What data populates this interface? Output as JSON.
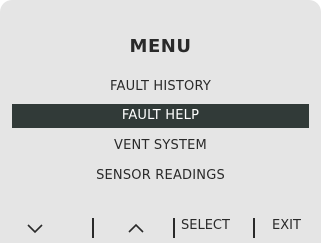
{
  "menu": {
    "title": "MENU",
    "items": [
      {
        "label": "FAULT HISTORY",
        "selected": false
      },
      {
        "label": "FAULT HELP",
        "selected": true
      },
      {
        "label": "VENT SYSTEM",
        "selected": false
      },
      {
        "label": "SENSOR READINGS",
        "selected": false
      }
    ]
  },
  "softkeys": {
    "down_icon": "chevron-down-icon",
    "up_icon": "chevron-up-icon",
    "select_label": "SELECT",
    "exit_label": "EXIT"
  },
  "colors": {
    "screen_bg": "#e5e5e5",
    "highlight_bg": "#313a38",
    "text": "#2a2a2a"
  }
}
